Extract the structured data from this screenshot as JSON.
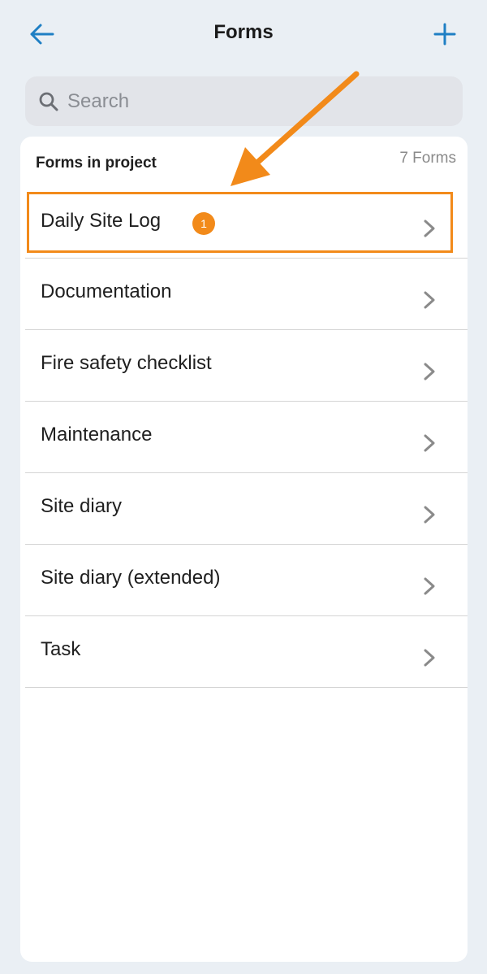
{
  "header": {
    "title": "Forms",
    "back_icon": "arrow-left-icon",
    "add_icon": "plus-icon"
  },
  "search": {
    "placeholder": "Search",
    "value": ""
  },
  "section": {
    "title": "Forms in project",
    "count": "7 Forms"
  },
  "forms": [
    {
      "label": "Daily Site Log",
      "badge": "1"
    },
    {
      "label": "Documentation"
    },
    {
      "label": "Fire safety checklist"
    },
    {
      "label": "Maintenance"
    },
    {
      "label": "Site diary"
    },
    {
      "label": "Site diary (extended)"
    },
    {
      "label": "Task"
    }
  ],
  "colors": {
    "accent": "#1f7fc4",
    "annotation": "#f28a1a",
    "background": "#eaeff4",
    "card": "#ffffff"
  }
}
